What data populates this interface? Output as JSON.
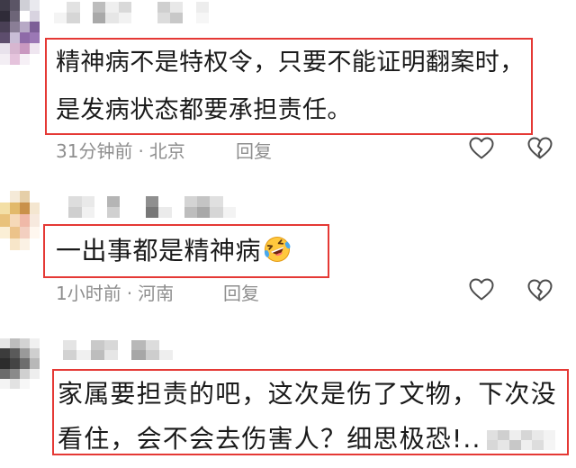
{
  "colors": {
    "highlight_border": "#e53935",
    "comment_text": "#1a1a1a",
    "meta_text": "#8e8e8e",
    "icon_stroke": "#4d4d4d"
  },
  "comments": [
    {
      "avatar_pixels": [
        [
          "#3e3a48",
          "#5b5566",
          "#cfcfd6",
          "#e9e9ee"
        ],
        [
          "#2f2b38",
          "#6d6578",
          "#ffffff",
          "#d8d3e0"
        ],
        [
          "#4a4056",
          "#8a7e96",
          "#b7a9c6",
          "#7d5f97"
        ],
        [
          "#5d4d6d",
          "#c9bdd6",
          "#8e6aa8",
          "#9b78b5"
        ],
        [
          "#e8e2ec",
          "#d7b6d0",
          "#c998c0",
          "#efe6f0"
        ],
        [
          "#f3eef4",
          "#e5c3dc",
          "#f6f0f6",
          "#ffffff"
        ]
      ],
      "username_pixels": [
        [
          "#ffffff",
          "#e2e2e2",
          "#ffffff",
          "#bdbdbd",
          "#efefef",
          "#d9d9d9",
          "#ffffff",
          "#ffffff",
          "#cfcfcf",
          "#e8e8e8",
          "#ffffff",
          "#ededed"
        ],
        [
          "#f4f4f4",
          "#d6d6d6",
          "#ffffff",
          "#a9a9a9",
          "#e6e6e6",
          "#f2f2f2",
          "#ffffff",
          "#ffffff",
          "#dcdcdc",
          "#c8c8c8",
          "#ffffff",
          "#f6f6f6"
        ]
      ],
      "text_lines": [
        "精神病不是特权令，只要不能证明翻案时，",
        "是发病状态都要承担责任。"
      ],
      "time": "31分钟前",
      "separator": "·",
      "location": "北京",
      "reply_label": "回复",
      "like_icon": "heart-outline-icon",
      "dislike_icon": "broken-heart-icon"
    },
    {
      "avatar_pixels": [
        [
          "#ffffff",
          "#f5ead8",
          "#e6cfa8",
          "#ffffff"
        ],
        [
          "#f3dfa6",
          "#e2b96a",
          "#c9914a",
          "#f4e6d0"
        ],
        [
          "#e9c27b",
          "#f6d9b8",
          "#f0b9a8",
          "#f7e9de"
        ],
        [
          "#fbefd6",
          "#ecc38a",
          "#f3cfc0",
          "#fff7ef"
        ],
        [
          "#ffffff",
          "#f7e6c9",
          "#fbf1e4",
          "#ffffff"
        ]
      ],
      "username_pixels": [
        [
          "#ffffff",
          "#dddddd",
          "#e9e9e9",
          "#ffffff",
          "#b5b5b5",
          "#ffffff",
          "#ffffff",
          "#8f8f8f",
          "#ffffff",
          "#ffffff",
          "#d4d4d4",
          "#c4c4c4",
          "#e0e0e0",
          "#ffffff"
        ],
        [
          "#ffffff",
          "#cfcfcf",
          "#f1f1f1",
          "#ffffff",
          "#d0d0d0",
          "#ffffff",
          "#ffffff",
          "#777777",
          "#ebebeb",
          "#ffffff",
          "#bdbdbd",
          "#a8a8a8",
          "#d6d6d6",
          "#f3f3f3"
        ]
      ],
      "text_lines": [
        "一出事都是精神病"
      ],
      "emoji_icon": "laughing-tears-emoji-icon",
      "time": "1小时前",
      "separator": "·",
      "location": "河南",
      "reply_label": "回复",
      "like_icon": "heart-outline-icon",
      "dislike_icon": "broken-heart-icon"
    },
    {
      "avatar_pixels": [
        [
          "#e6e6e6",
          "#bdbdbd",
          "#d3d3d3",
          "#f0f0f0"
        ],
        [
          "#3c3c3c",
          "#5a5a5a",
          "#9a9a9a",
          "#cfcfcf"
        ],
        [
          "#2c2c2c",
          "#444444",
          "#6e6e6e",
          "#b8b8b8"
        ],
        [
          "#6b6b6b",
          "#8a8a8a",
          "#d0d0d0",
          "#eeeeee"
        ],
        [
          "#f4f4f4",
          "#e2e2e2",
          "#f7f7f7",
          "#ffffff"
        ]
      ],
      "username_pixels": [
        [
          "#e4e4e4",
          "#ffffff",
          "#c9c9c9",
          "#d8d8d8",
          "#ffffff",
          "#b8b8b8",
          "#dcdcdc",
          "#ffffff"
        ],
        [
          "#d2d2d2",
          "#f0f0f0",
          "#bdbdbd",
          "#e6e6e6",
          "#ffffff",
          "#a7a7a7",
          "#cdcdcd",
          "#eeeeee"
        ]
      ],
      "text_lines": [
        "家属要担责的吧，这次是伤了文物，下次没",
        "看住，会不会去伤害人？细思极恐!.."
      ],
      "redacted_tail_pixels": [
        [
          "#e0e0e0",
          "#cfcfcf",
          "#eeeeee",
          "#d6d6d6",
          "#e9e9e9",
          "#f3f3f3"
        ],
        [
          "#d8d8d8",
          "#e6e6e6",
          "#c8c8c8",
          "#efefef",
          "#dddddd",
          "#f5f5f5"
        ]
      ]
    }
  ]
}
